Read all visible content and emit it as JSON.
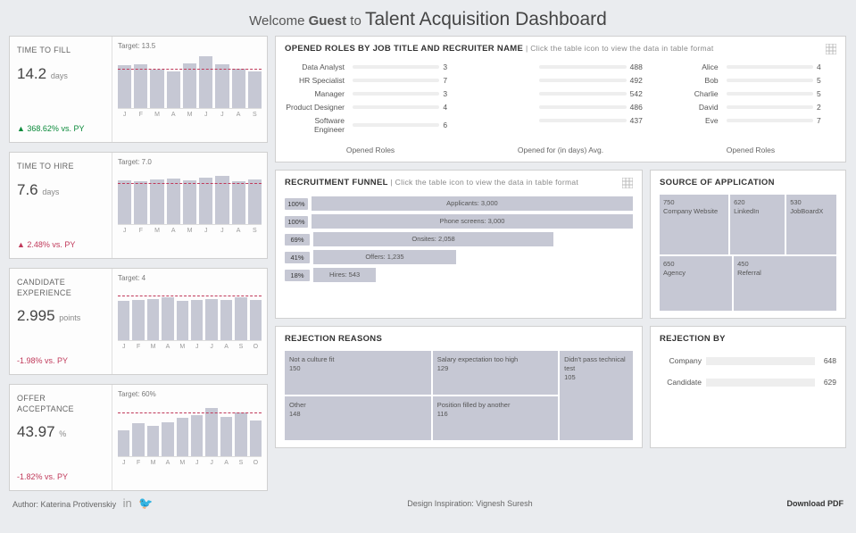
{
  "header": {
    "welcome": "Welcome",
    "guest": "Guest",
    "to": "to",
    "title": "Talent Acquisition Dashboard"
  },
  "months10": [
    "J",
    "F",
    "M",
    "A",
    "M",
    "J",
    "J",
    "A",
    "S",
    "O"
  ],
  "months9": [
    "J",
    "F",
    "M",
    "A",
    "M",
    "J",
    "J",
    "A",
    "S"
  ],
  "kpi": [
    {
      "title": "TIME TO FILL",
      "value": "14.2",
      "unit": "days",
      "delta": "▲ 368.62% vs. PY",
      "deltaClass": "pos",
      "target": "Target: 13.5",
      "targetPos": 28,
      "months": 9,
      "bars": [
        78,
        80,
        70,
        68,
        82,
        95,
        80,
        72,
        68
      ]
    },
    {
      "title": "TIME TO HIRE",
      "value": "7.6",
      "unit": "days",
      "delta": "▲ 2.48% vs. PY",
      "deltaClass": "neg",
      "target": "Target: 7.0",
      "targetPos": 25,
      "months": 9,
      "bars": [
        80,
        78,
        82,
        84,
        80,
        86,
        88,
        78,
        82
      ]
    },
    {
      "title": "CANDIDATE EXPERIENCE",
      "value": "2.995",
      "unit": "points",
      "delta": "-1.98% vs. PY",
      "deltaClass": "neg",
      "target": "Target: 4",
      "targetPos": 18,
      "months": 10,
      "bars": [
        72,
        74,
        76,
        78,
        72,
        74,
        76,
        74,
        78,
        74
      ]
    },
    {
      "title": "OFFER ACCEPTANCE",
      "value": "43.97",
      "unit": "%",
      "delta": "-1.82% vs. PY",
      "deltaClass": "neg",
      "target": "Target: 60%",
      "targetPos": 20,
      "months": 10,
      "bars": [
        48,
        60,
        55,
        62,
        70,
        75,
        88,
        72,
        80,
        65
      ]
    }
  ],
  "opened": {
    "title": "OPENED ROLES by job title and recruiter name",
    "sub": "| Click the table icon to view the data in table format",
    "footer": [
      "Opened Roles",
      "Opened for (in days) Avg.",
      "Opened Roles"
    ],
    "col1": [
      {
        "lbl": "Data Analyst",
        "val": 3,
        "pct": 43
      },
      {
        "lbl": "HR Specialist",
        "val": 7,
        "pct": 100
      },
      {
        "lbl": "Manager",
        "val": 3,
        "pct": 43
      },
      {
        "lbl": "Product Designer",
        "val": 4,
        "pct": 57
      },
      {
        "lbl": "Software Engineer",
        "val": 6,
        "pct": 86
      }
    ],
    "col2": [
      {
        "lbl": "",
        "val": 488,
        "pct": 90
      },
      {
        "lbl": "",
        "val": 492,
        "pct": 91
      },
      {
        "lbl": "",
        "val": 542,
        "pct": 100
      },
      {
        "lbl": "",
        "val": 486,
        "pct": 90
      },
      {
        "lbl": "",
        "val": 437,
        "pct": 81
      }
    ],
    "col3": [
      {
        "lbl": "Alice",
        "val": 4,
        "pct": 57
      },
      {
        "lbl": "Bob",
        "val": 5,
        "pct": 71
      },
      {
        "lbl": "Charlie",
        "val": 5,
        "pct": 71
      },
      {
        "lbl": "David",
        "val": 2,
        "pct": 29
      },
      {
        "lbl": "Eve",
        "val": 7,
        "pct": 100
      }
    ]
  },
  "funnel": {
    "title": "RECRUITMENT FUNNEL",
    "sub": "| Click the table icon to view the data in table format",
    "rows": [
      {
        "pct": "100%",
        "label": "Applicants: 3,000",
        "width": 100
      },
      {
        "pct": "100%",
        "label": "Phone screens: 3,000",
        "width": 100
      },
      {
        "pct": "69%",
        "label": "Onsites: 2,058",
        "width": 69
      },
      {
        "pct": "41%",
        "label": "Offers: 1,235",
        "width": 41
      },
      {
        "pct": "18%",
        "label": "Hires: 543",
        "width": 18
      }
    ]
  },
  "source": {
    "title": "SOURCE OF APPLICATION",
    "cells": [
      {
        "n": "750",
        "lbl": "Company Website"
      },
      {
        "n": "620",
        "lbl": "LinkedIn"
      },
      {
        "n": "530",
        "lbl": "JobBoardX"
      },
      {
        "n": "650",
        "lbl": "Agency"
      },
      {
        "n": "450",
        "lbl": "Referral"
      }
    ]
  },
  "rejreasons": {
    "title": "REJECTION REASONS",
    "cells": [
      {
        "lbl": "Not a culture fit",
        "n": "150"
      },
      {
        "lbl": "Salary expectation too high",
        "n": "129"
      },
      {
        "lbl": "Didn't pass technical test",
        "n": "105"
      },
      {
        "lbl": "Other",
        "n": "148"
      },
      {
        "lbl": "Position filled by another",
        "n": "116"
      }
    ]
  },
  "rejby": {
    "title": "REJECTION BY",
    "rows": [
      {
        "lbl": "Company",
        "val": 648,
        "pct": 100
      },
      {
        "lbl": "Candidate",
        "val": 629,
        "pct": 97
      }
    ]
  },
  "footer": {
    "author_label": "Author:",
    "author": "Katerina Protivenskiy",
    "inspiration_label": "Design Inspiration:",
    "inspiration": "Vignesh Suresh",
    "download": "Download PDF"
  },
  "chart_data": [
    {
      "type": "bar",
      "title": "Time to Fill by month",
      "categories": [
        "J",
        "F",
        "M",
        "A",
        "M",
        "J",
        "J",
        "A",
        "S"
      ],
      "values": [
        13.0,
        13.3,
        11.7,
        11.3,
        13.7,
        15.8,
        13.3,
        12.0,
        11.3
      ],
      "target": 13.5,
      "ylabel": "days"
    },
    {
      "type": "bar",
      "title": "Time to Hire by month",
      "categories": [
        "J",
        "F",
        "M",
        "A",
        "M",
        "J",
        "J",
        "A",
        "S"
      ],
      "values": [
        7.2,
        7.0,
        7.4,
        7.6,
        7.2,
        7.7,
        7.9,
        7.0,
        7.4
      ],
      "target": 7.0,
      "ylabel": "days"
    },
    {
      "type": "bar",
      "title": "Candidate Experience by month",
      "categories": [
        "J",
        "F",
        "M",
        "A",
        "M",
        "J",
        "J",
        "A",
        "S",
        "O"
      ],
      "values": [
        2.9,
        3.0,
        3.0,
        3.1,
        2.9,
        3.0,
        3.0,
        3.0,
        3.1,
        3.0
      ],
      "target": 4,
      "ylabel": "points"
    },
    {
      "type": "bar",
      "title": "Offer Acceptance by month",
      "categories": [
        "J",
        "F",
        "M",
        "A",
        "M",
        "J",
        "J",
        "A",
        "S",
        "O"
      ],
      "values": [
        33,
        42,
        38,
        43,
        49,
        52,
        61,
        50,
        56,
        45
      ],
      "target": 60,
      "ylabel": "%"
    },
    {
      "type": "bar",
      "title": "Opened Roles by job title",
      "categories": [
        "Data Analyst",
        "HR Specialist",
        "Manager",
        "Product Designer",
        "Software Engineer"
      ],
      "values": [
        3,
        7,
        3,
        4,
        6
      ]
    },
    {
      "type": "bar",
      "title": "Opened for (in days) Avg. by job title",
      "categories": [
        "Data Analyst",
        "HR Specialist",
        "Manager",
        "Product Designer",
        "Software Engineer"
      ],
      "values": [
        488,
        492,
        542,
        486,
        437
      ]
    },
    {
      "type": "bar",
      "title": "Opened Roles by recruiter",
      "categories": [
        "Alice",
        "Bob",
        "Charlie",
        "David",
        "Eve"
      ],
      "values": [
        4,
        5,
        5,
        2,
        7
      ]
    },
    {
      "type": "bar",
      "title": "Recruitment Funnel",
      "categories": [
        "Applicants",
        "Phone screens",
        "Onsites",
        "Offers",
        "Hires"
      ],
      "values": [
        3000,
        3000,
        2058,
        1235,
        543
      ]
    },
    {
      "type": "treemap",
      "title": "Source of Application",
      "categories": [
        "Company Website",
        "Agency",
        "LinkedIn",
        "JobBoardX",
        "Referral"
      ],
      "values": [
        750,
        650,
        620,
        530,
        450
      ]
    },
    {
      "type": "treemap",
      "title": "Rejection Reasons",
      "categories": [
        "Not a culture fit",
        "Other",
        "Salary expectation too high",
        "Position filled by another",
        "Didn't pass technical test"
      ],
      "values": [
        150,
        148,
        129,
        116,
        105
      ]
    },
    {
      "type": "bar",
      "title": "Rejection By",
      "categories": [
        "Company",
        "Candidate"
      ],
      "values": [
        648,
        629
      ]
    }
  ]
}
